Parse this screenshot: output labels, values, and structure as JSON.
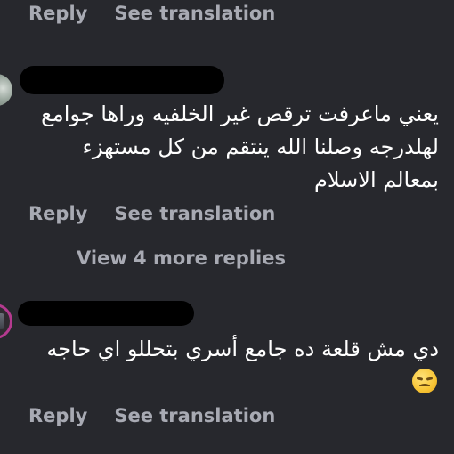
{
  "actions": {
    "reply_label": "Reply",
    "translate_label": "See translation"
  },
  "comments": [
    {
      "avatar_icon": "avatar-photo",
      "text": "يعني ماعرفت ترقص غير الخلفيه وراها جوامع لهلدرجه وصلنا الله ينتقم من كل مستهزء بمعالم الاسلام",
      "view_replies": "View 4 more replies"
    },
    {
      "avatar_icon": "avatar-photo-story-ring",
      "text": "دي مش قلعة ده جامع أسري  بتحللو اي حاجه",
      "emoji": "unamused-face-emoji"
    }
  ],
  "colors": {
    "background": "#27282d",
    "text": "#ffffff",
    "secondary_text": "#a8aab3",
    "story_ring": "#b43a8f"
  }
}
